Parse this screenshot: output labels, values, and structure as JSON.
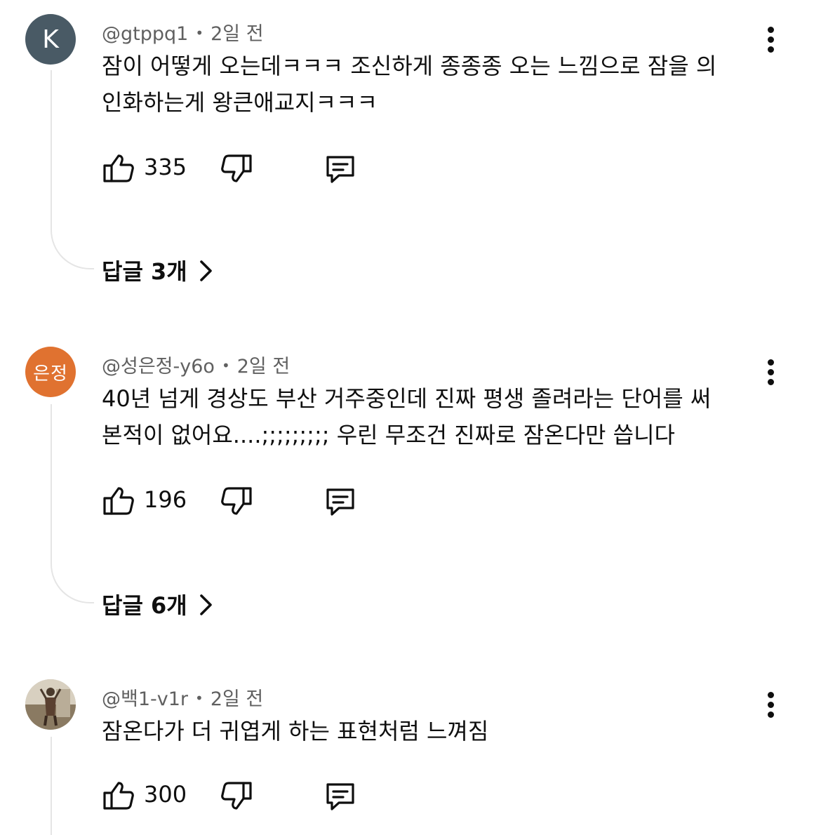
{
  "comments": [
    {
      "avatar_text": "K",
      "author": "@gtppq1",
      "time": "2일 전",
      "lines": [
        "잠이 어떻게 오는데ㅋㅋㅋ 조신하게 종종종 오는 느낌으로 잠을 의",
        "인화하는게 왕큰애교지ㅋㅋㅋ"
      ],
      "likes": "335",
      "replies": "답글 3개"
    },
    {
      "avatar_text": "은정",
      "author": "@성은정-y6o",
      "time": "2일 전",
      "lines": [
        "40년 넘게 경상도 부산 거주중인데 진짜 평생 졸려라는 단어를 써",
        "본적이 없어요....;;;;;;;;; 우린 무조건 진짜로 잠온다만 씁니다"
      ],
      "likes": "196",
      "replies": "답글 6개"
    },
    {
      "avatar_text": "",
      "author": "@백1-v1r",
      "time": "2일 전",
      "lines": [
        "잠온다가 더 귀엽게 하는 표현처럼 느껴짐"
      ],
      "likes": "300"
    }
  ],
  "separator": "•",
  "icons": {
    "like": "thumb-up-icon",
    "dislike": "thumb-down-icon",
    "reply": "comment-icon",
    "more": "more-vert-icon",
    "expand": "chevron-right-icon"
  },
  "colors": {
    "avatar_k": "#495a65",
    "avatar_orange": "#e07230",
    "meta_text": "#606060",
    "thread_line": "#e5e5e5"
  }
}
